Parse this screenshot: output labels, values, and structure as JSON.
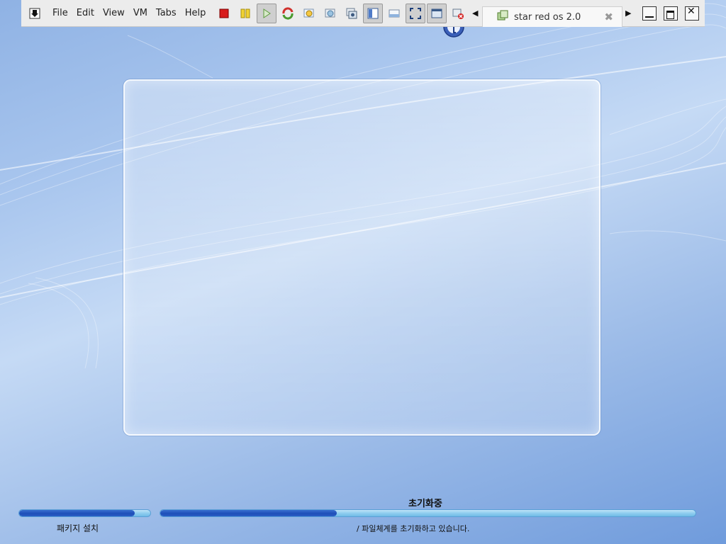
{
  "toolbar": {
    "menus": [
      "File",
      "Edit",
      "View",
      "VM",
      "Tabs",
      "Help"
    ],
    "tab": {
      "label": "star red os 2.0"
    }
  },
  "install": {
    "left_label": "패키지 설치",
    "left_progress": 0.88,
    "right_title": "초기화중",
    "right_progress": 0.33,
    "status": "/ 파일체계를 초기화하고 있습니다."
  },
  "colors": {
    "accent_fill": "#1f4fb8",
    "bar_track": "#8fcdef",
    "toolbar_bg": "#ececec"
  },
  "icons": [
    "pin-icon",
    "stop-icon",
    "pause-icon",
    "play-icon",
    "refresh-icon",
    "snapshot-icon",
    "revert-icon",
    "manage-snapshots-icon",
    "console-view-icon",
    "quick-switch-icon",
    "fullscreen-icon",
    "unity-icon",
    "disconnect-icon",
    "clock-icon"
  ]
}
